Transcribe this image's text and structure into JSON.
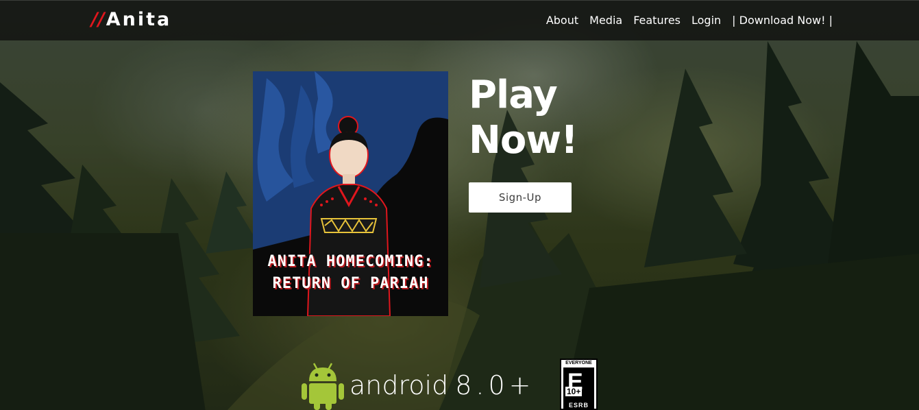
{
  "nav": {
    "logo_slashes": "//",
    "logo_text": "Anita",
    "links": [
      {
        "label": "About"
      },
      {
        "label": "Media"
      },
      {
        "label": "Features"
      },
      {
        "label": "Login"
      },
      {
        "label": "| Download Now! |"
      }
    ]
  },
  "hero": {
    "cover_title_line1": "ANITA HOMECOMING:",
    "cover_title_line2": "RETURN OF PARIAH",
    "heading_line1": "Play",
    "heading_line2": "Now!",
    "signup_label": "Sign-Up"
  },
  "platform": {
    "android_label": "android",
    "android_version": "8.0+"
  },
  "rating": {
    "top_text": "EVERYONE 10+",
    "letter": "E",
    "age": "10+",
    "org": "ESRB"
  },
  "colors": {
    "accent": "#e0161d",
    "android_green": "#a4c639",
    "nav_bg": "#16181a"
  }
}
